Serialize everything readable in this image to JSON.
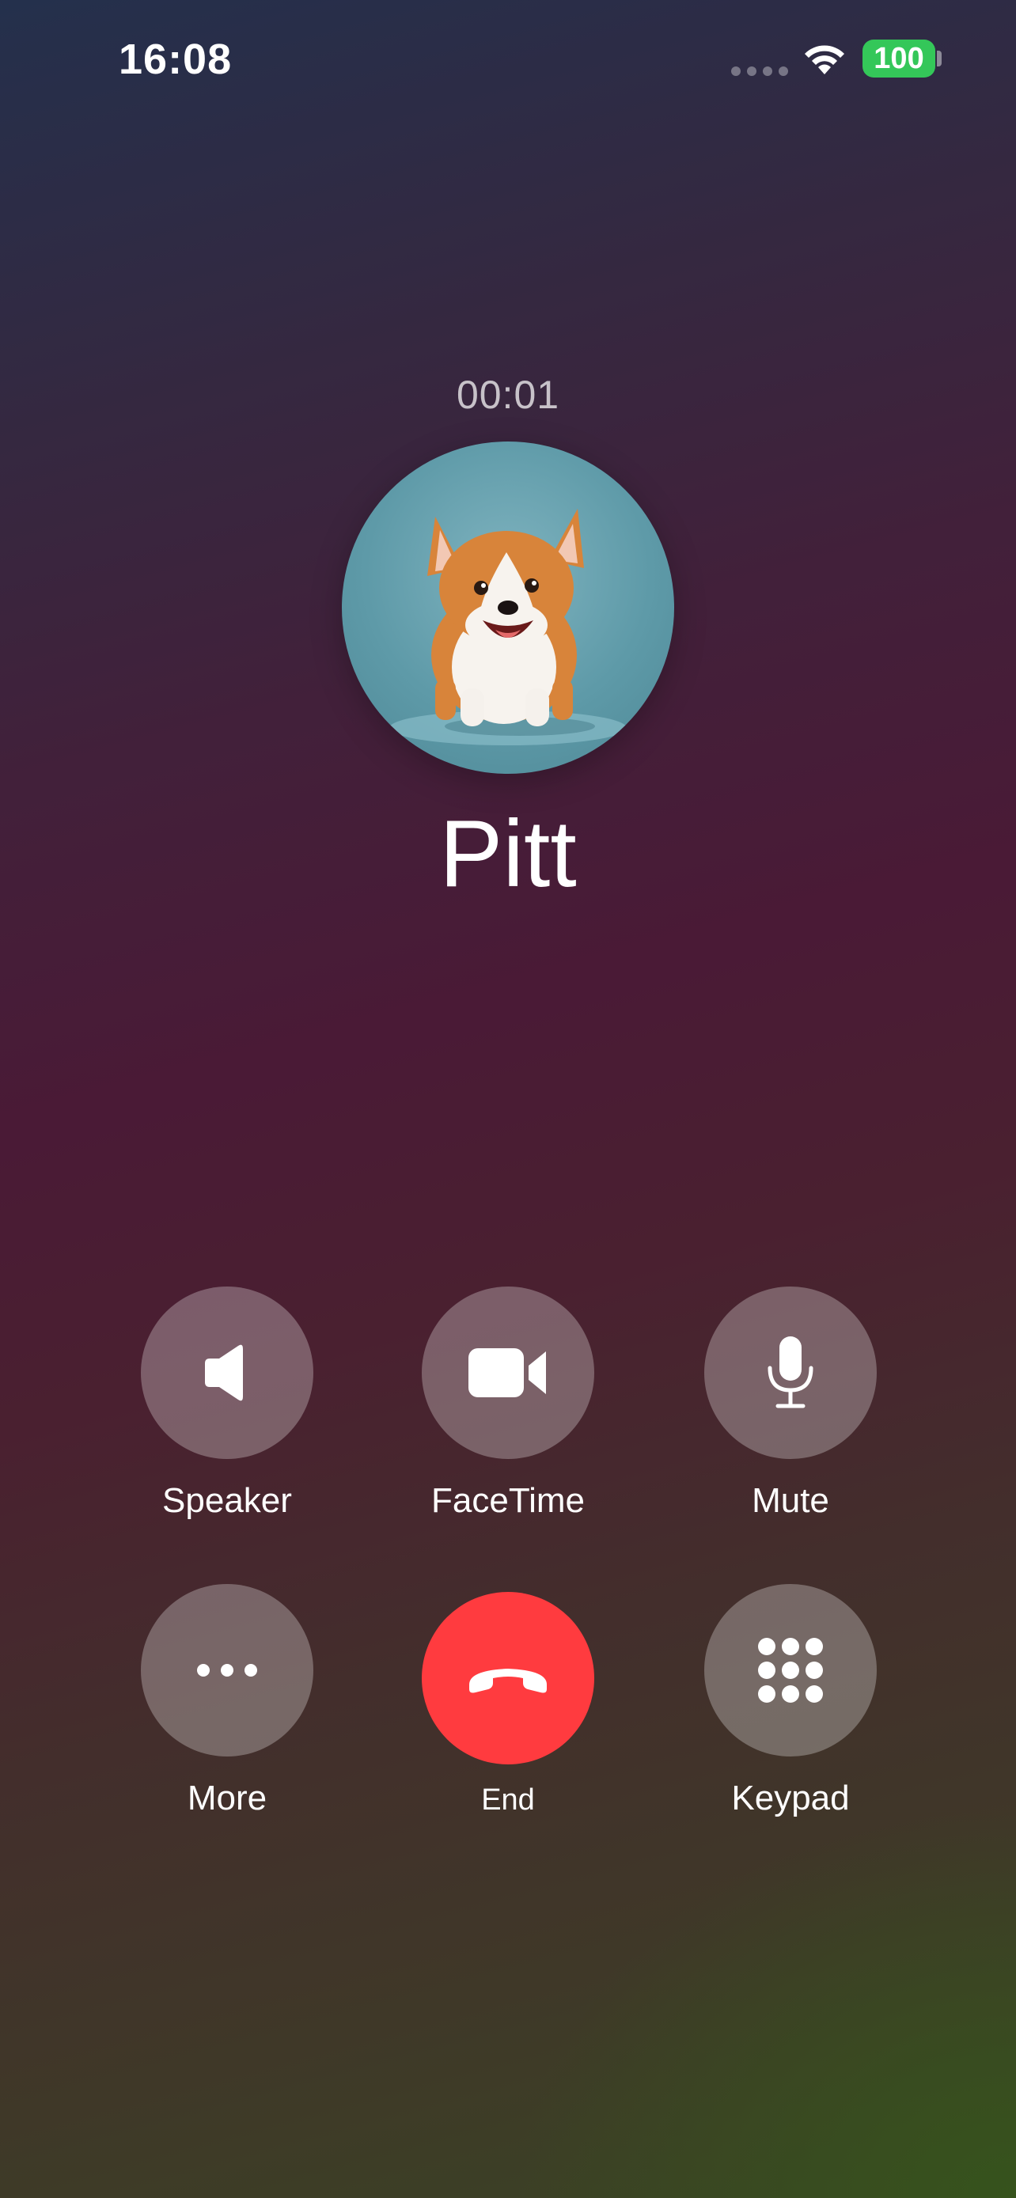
{
  "status_bar": {
    "time": "16:08",
    "battery": "100"
  },
  "call": {
    "timer": "00:01",
    "contact_name": "Pitt"
  },
  "controls": {
    "speaker": "Speaker",
    "facetime": "FaceTime",
    "mute": "Mute",
    "more": "More",
    "end": "End",
    "keypad": "Keypad"
  },
  "colors": {
    "end_button": "#ff3b3f",
    "battery": "#34c759"
  },
  "icons": {
    "speaker": "speaker-icon",
    "facetime": "video-camera-icon",
    "mute": "microphone-icon",
    "more": "ellipsis-icon",
    "end": "phone-hangup-icon",
    "keypad": "keypad-icon"
  }
}
